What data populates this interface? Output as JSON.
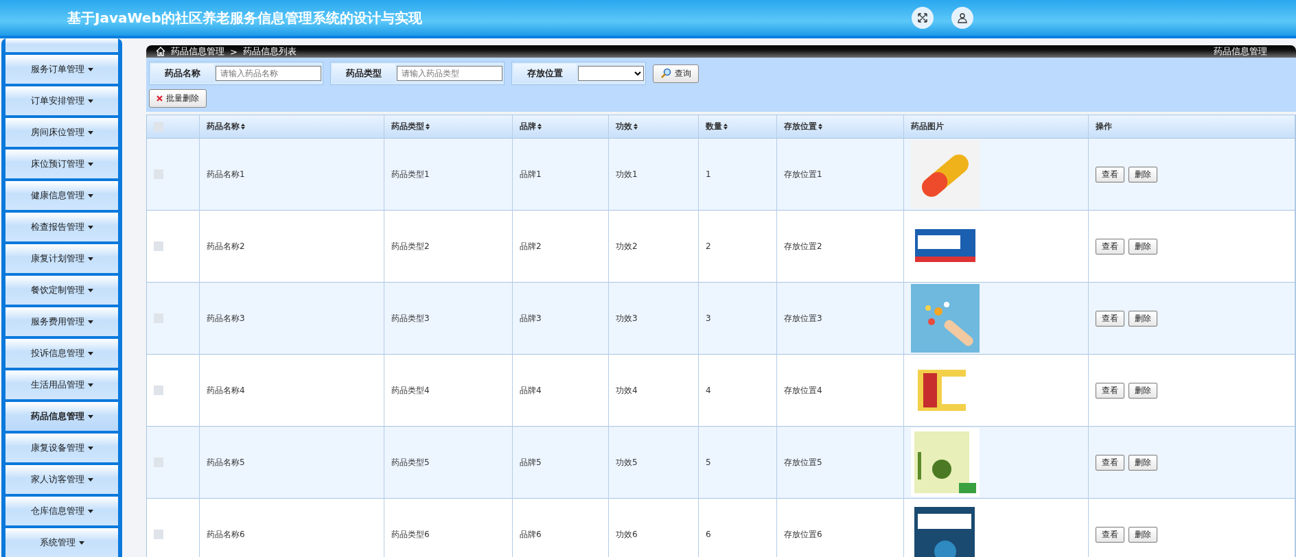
{
  "header": {
    "title": "基于JavaWeb的社区养老服务信息管理系统的设计与实现"
  },
  "sidebar": {
    "items": [
      {
        "selected": false
      },
      {
        "label": "服务订单管理",
        "selected": false
      },
      {
        "label": "订单安排管理",
        "selected": false
      },
      {
        "label": "房间床位管理",
        "selected": false
      },
      {
        "label": "床位预订管理",
        "selected": false
      },
      {
        "label": "健康信息管理",
        "selected": false
      },
      {
        "label": "检查报告管理",
        "selected": false
      },
      {
        "label": "康复计划管理",
        "selected": false
      },
      {
        "label": "餐饮定制管理",
        "selected": false
      },
      {
        "label": "服务费用管理",
        "selected": false
      },
      {
        "label": "投诉信息管理",
        "selected": false
      },
      {
        "label": "生活用品管理",
        "selected": false
      },
      {
        "label": "药品信息管理",
        "selected": true
      },
      {
        "label": "康复设备管理",
        "selected": false
      },
      {
        "label": "家人访客管理",
        "selected": false
      },
      {
        "label": "仓库信息管理",
        "selected": false
      },
      {
        "label": "系统管理",
        "selected": false
      }
    ]
  },
  "breadcrumb": {
    "path": "药品信息管理",
    "separator": ">",
    "current": "药品信息列表",
    "right_title": "药品信息管理"
  },
  "filters": [
    {
      "label": "药品名称",
      "kind": "text",
      "placeholder": "请输入药品名称"
    },
    {
      "label": "药品类型",
      "kind": "text",
      "placeholder": "请输入药品类型"
    },
    {
      "label": "存放位置",
      "kind": "select"
    }
  ],
  "search_button": "查询",
  "batch_delete_button": "批量删除",
  "table": {
    "select_all": {
      "checked": false
    },
    "columns": [
      {
        "label": "药品名称",
        "sortable": true
      },
      {
        "label": "药品类型",
        "sortable": true
      },
      {
        "label": "品牌",
        "sortable": true
      },
      {
        "label": "功效",
        "sortable": true
      },
      {
        "label": "数量",
        "sortable": true
      },
      {
        "label": "存放位置",
        "sortable": true
      },
      {
        "label": "药品图片",
        "sortable": false
      },
      {
        "label": "操作",
        "sortable": false
      }
    ],
    "rows": [
      {
        "checked": false,
        "name": "药品名称1",
        "type": "药品类型1",
        "brand": "品牌1",
        "effect": "功效1",
        "quantity": "1",
        "location": "存放位置1",
        "image": {
          "kind": "picture"
        },
        "actions": [
          "查看",
          "删除"
        ]
      },
      {
        "checked": false,
        "name": "药品名称2",
        "type": "药品类型2",
        "brand": "品牌2",
        "effect": "功效2",
        "quantity": "2",
        "location": "存放位置2",
        "image": {
          "kind": "picture"
        },
        "actions": [
          "查看",
          "删除"
        ]
      },
      {
        "checked": false,
        "name": "药品名称3",
        "type": "药品类型3",
        "brand": "品牌3",
        "effect": "功效3",
        "quantity": "3",
        "location": "存放位置3",
        "image": {
          "kind": "picture"
        },
        "actions": [
          "查看",
          "删除"
        ]
      },
      {
        "checked": false,
        "name": "药品名称4",
        "type": "药品类型4",
        "brand": "品牌4",
        "effect": "功效4",
        "quantity": "4",
        "location": "存放位置4",
        "image": {
          "kind": "picture"
        },
        "actions": [
          "查看",
          "删除"
        ]
      },
      {
        "checked": false,
        "name": "药品名称5",
        "type": "药品类型5",
        "brand": "品牌5",
        "effect": "功效5",
        "quantity": "5",
        "location": "存放位置5",
        "image": {
          "kind": "picture"
        },
        "actions": [
          "查看",
          "删除"
        ]
      },
      {
        "checked": false,
        "name": "药品名称6",
        "type": "药品类型6",
        "brand": "品牌6",
        "effect": "功效6",
        "quantity": "6",
        "location": "存放位置6",
        "image": {
          "kind": "picture"
        },
        "actions": [
          "查看",
          "删除"
        ]
      }
    ]
  }
}
